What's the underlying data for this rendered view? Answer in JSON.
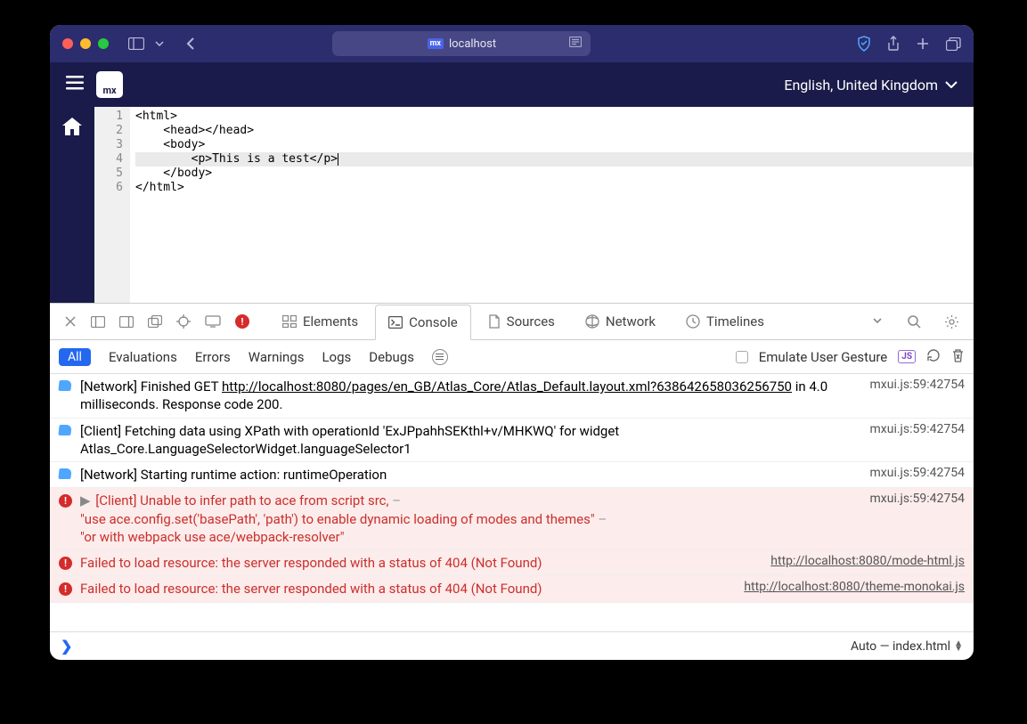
{
  "browser": {
    "address": "localhost",
    "badge": "mx"
  },
  "app": {
    "logo": "mx",
    "language": "English, United Kingdom"
  },
  "editor": {
    "gutter": [
      "1",
      "2",
      "3",
      "4",
      "5",
      "6"
    ],
    "lines": [
      "<html>",
      "    <head></head>",
      "    <body>",
      "        <p>This is a test</p>",
      "    </body>",
      "</html>"
    ],
    "active_line_index": 3
  },
  "devtools": {
    "error_count": "!",
    "tabs": {
      "elements": "Elements",
      "console": "Console",
      "sources": "Sources",
      "network": "Network",
      "timelines": "Timelines"
    }
  },
  "console_filters": {
    "all": "All",
    "evaluations": "Evaluations",
    "errors": "Errors",
    "warnings": "Warnings",
    "logs": "Logs",
    "debugs": "Debugs",
    "emulate": "Emulate User Gesture",
    "js_badge": "JS"
  },
  "console": {
    "rows": [
      {
        "type": "info",
        "prefix": "[Network] Finished GET ",
        "link": "http://localhost:8080/pages/en_GB/Atlas_Core/Atlas_Default.layout.xml?638642658036256750",
        "suffix": " in 4.0 milliseconds. Response code 200.",
        "src": "mxui.js:59:42754"
      },
      {
        "type": "info",
        "msg": "[Client] Fetching data using XPath with operationId 'ExJPpahhSEKthl+v/MHKWQ' for widget Atlas_Core.LanguageSelectorWidget.languageSelector1",
        "src": "mxui.js:59:42754"
      },
      {
        "type": "info",
        "msg": "[Network] Starting runtime action: runtimeOperation",
        "src": "mxui.js:59:42754"
      },
      {
        "type": "error_multi",
        "line1": "[Client] Unable to infer path to ace from script src,",
        "line2": "\"use ace.config.set('basePath', 'path') to enable dynamic loading of modes and themes\"",
        "line3": "\"or with webpack use ace/webpack-resolver\"",
        "src": "mxui.js:59:42754"
      },
      {
        "type": "error_link",
        "msg": "Failed to load resource: the server responded with a status of 404 (Not Found)",
        "link": "http://localhost:8080/mode-html.js"
      },
      {
        "type": "error_link",
        "msg": "Failed to load resource: the server responded with a status of 404 (Not Found)",
        "link": "http://localhost:8080/theme-monokai.js"
      }
    ]
  },
  "bottom": {
    "context": "Auto — index.html"
  }
}
